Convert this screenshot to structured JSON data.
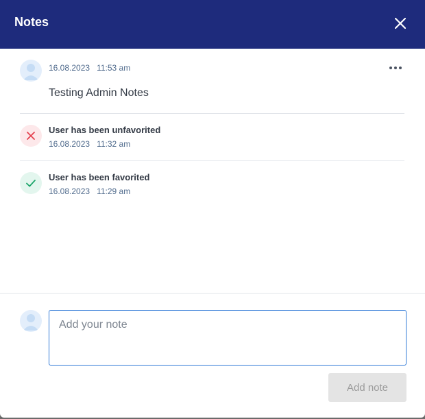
{
  "header": {
    "title": "Notes"
  },
  "notes": [
    {
      "date": "16.08.2023",
      "time": "11:53 am",
      "text": "Testing Admin Notes"
    }
  ],
  "events": [
    {
      "title": "User has been unfavorited",
      "date": "16.08.2023",
      "time": "11:32 am",
      "status": "negative",
      "color": "#e5414f"
    },
    {
      "title": "User has been favorited",
      "date": "16.08.2023",
      "time": "11:29 am",
      "status": "positive",
      "color": "#1ca56a"
    }
  ],
  "composer": {
    "placeholder": "Add your note",
    "submit_label": "Add note"
  },
  "theme": {
    "header_bg": "#1e2b7c",
    "input_border": "#2f79d6"
  }
}
